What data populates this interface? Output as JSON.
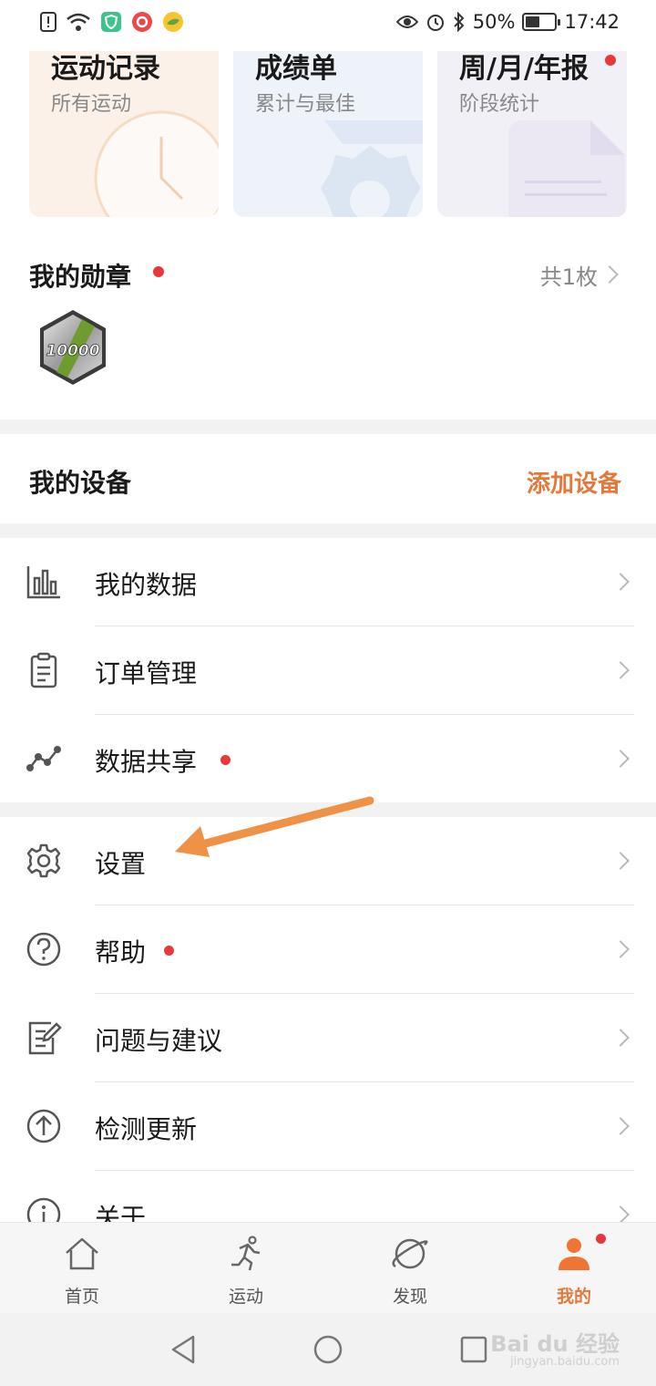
{
  "status_bar": {
    "battery_percent": "50%",
    "battery_level": 0.5,
    "time": "17:42"
  },
  "cards": [
    {
      "title": "运动记录",
      "subtitle": "所有运动",
      "has_dot": false
    },
    {
      "title": "成绩单",
      "subtitle": "累计与最佳",
      "has_dot": false
    },
    {
      "title": "周/月/年报",
      "subtitle": "阶段统计",
      "has_dot": true
    }
  ],
  "medals": {
    "title": "我的勋章",
    "count": "共1枚",
    "badge_text": "10000"
  },
  "devices": {
    "title": "我的设备",
    "add_label": "添加设备"
  },
  "menu_group_1": [
    {
      "label": "我的数据",
      "icon": "bar-chart-icon",
      "dot": false
    },
    {
      "label": "订单管理",
      "icon": "clipboard-icon",
      "dot": false
    },
    {
      "label": "数据共享",
      "icon": "share-line-icon",
      "dot": true
    }
  ],
  "menu_group_2": [
    {
      "label": "设置",
      "icon": "gear-icon",
      "dot": false
    },
    {
      "label": "帮助",
      "icon": "help-icon",
      "dot": true
    },
    {
      "label": "问题与建议",
      "icon": "feedback-icon",
      "dot": false
    },
    {
      "label": "检测更新",
      "icon": "update-icon",
      "dot": false
    },
    {
      "label": "关于",
      "icon": "info-icon",
      "dot": false
    }
  ],
  "bottom_nav": [
    {
      "label": "首页",
      "icon": "home-icon",
      "active": false
    },
    {
      "label": "运动",
      "icon": "running-icon",
      "active": false
    },
    {
      "label": "发现",
      "icon": "planet-icon",
      "active": false
    },
    {
      "label": "我的",
      "icon": "person-icon",
      "active": true
    }
  ],
  "watermark": {
    "main": "Bai du 经验",
    "sub": "jingyan.baidu.com"
  },
  "colors": {
    "accent": "#e2793a",
    "dot": "#e8383d",
    "arrow": "#ef9245"
  }
}
